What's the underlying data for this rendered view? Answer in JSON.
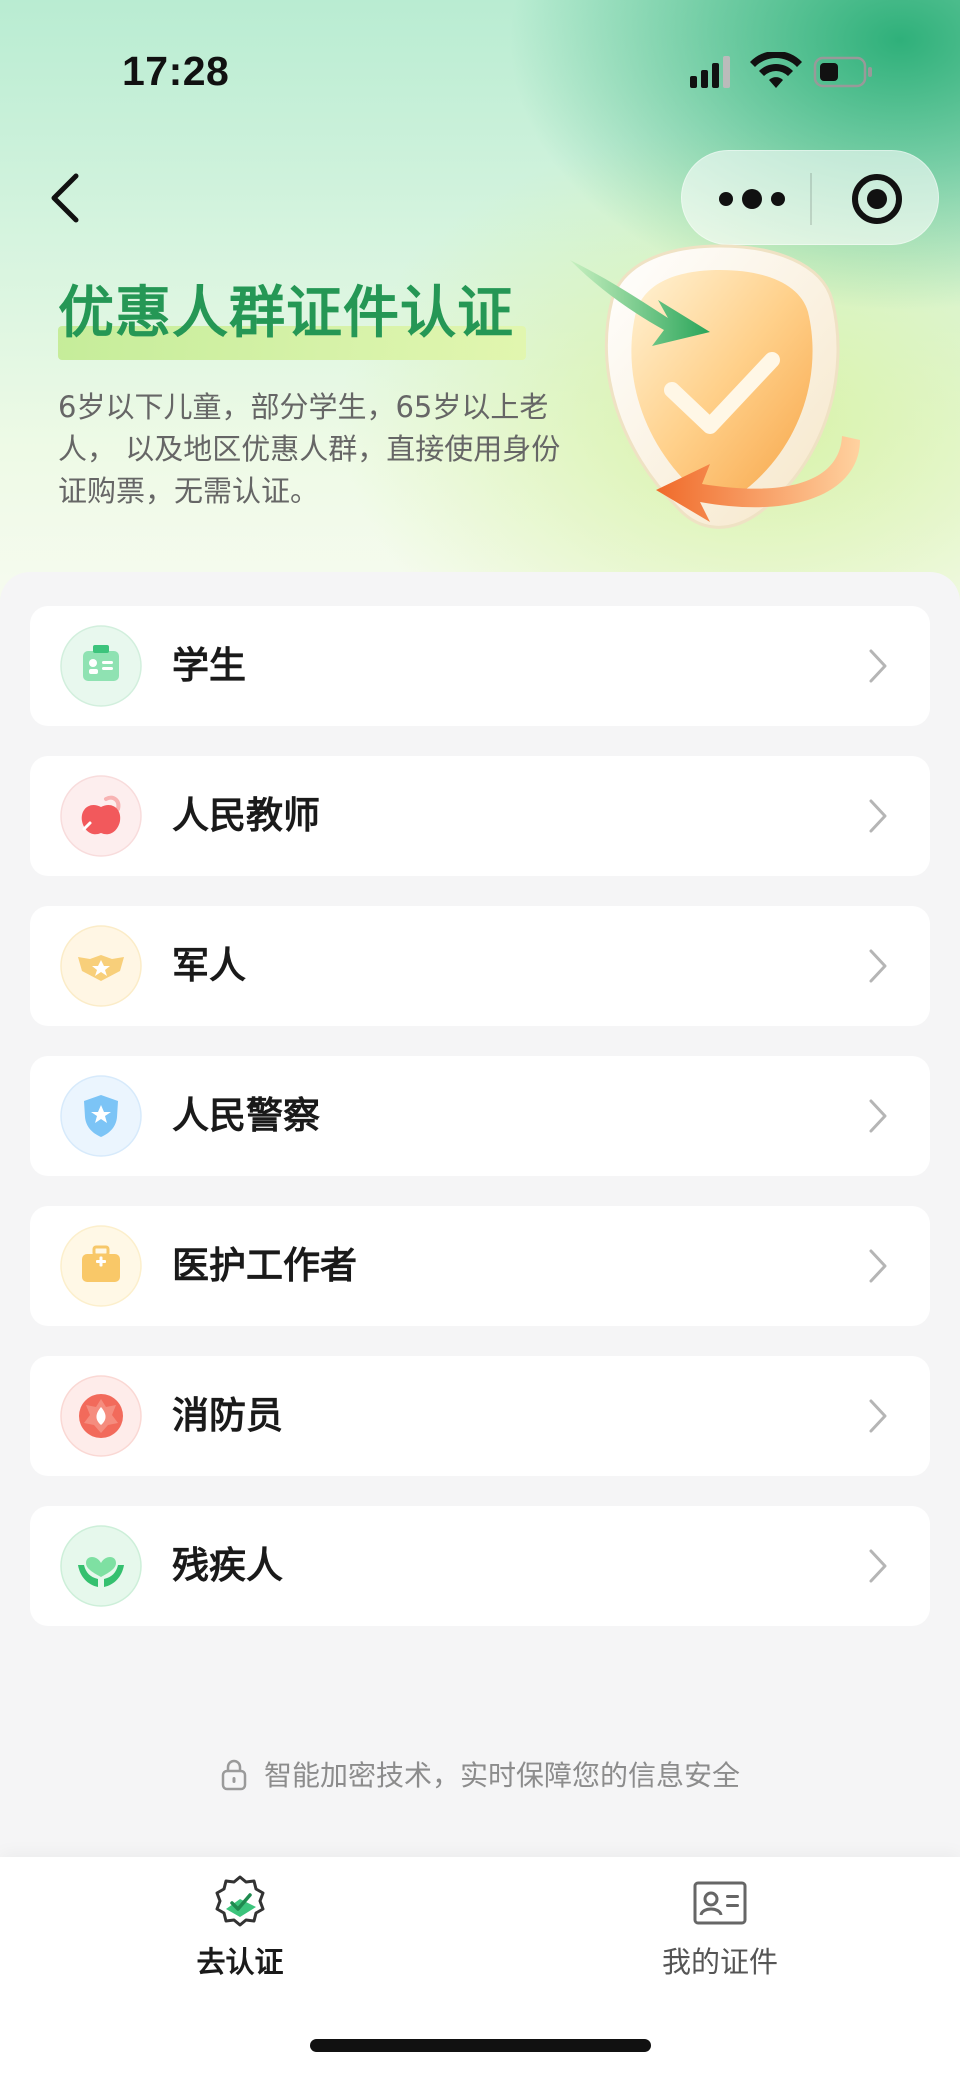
{
  "status_bar": {
    "time": "17:28"
  },
  "nav": {
    "back_icon": "chevron-left-icon",
    "more_icon": "more-dots-icon",
    "close_icon": "target-close-icon"
  },
  "header": {
    "title": "优惠人群证件认证",
    "description": "6岁以下儿童，部分学生，65岁以上老人， 以及地区优惠人群，直接使用身份证购票，无需认证。",
    "title_color": "#259755"
  },
  "categories": [
    {
      "label": "学生",
      "icon": "student-id-card-icon",
      "color": "#3cc47c"
    },
    {
      "label": "人民教师",
      "icon": "teacher-apple-icon",
      "color": "#f2595c"
    },
    {
      "label": "军人",
      "icon": "military-badge-icon",
      "color": "#f5b63c"
    },
    {
      "label": "人民警察",
      "icon": "police-shield-icon",
      "color": "#3ea6f0"
    },
    {
      "label": "医护工作者",
      "icon": "medical-kit-icon",
      "color": "#f7b84a"
    },
    {
      "label": "消防员",
      "icon": "fire-emblem-icon",
      "color": "#f05a4b"
    },
    {
      "label": "残疾人",
      "icon": "heart-hands-icon",
      "color": "#35c06f"
    }
  ],
  "security_note": "智能加密技术，实时保障您的信息安全",
  "tabbar": {
    "tabs": [
      {
        "label": "去认证",
        "icon": "certify-badge-icon",
        "active": true
      },
      {
        "label": "我的证件",
        "icon": "id-card-icon",
        "active": false
      }
    ]
  }
}
